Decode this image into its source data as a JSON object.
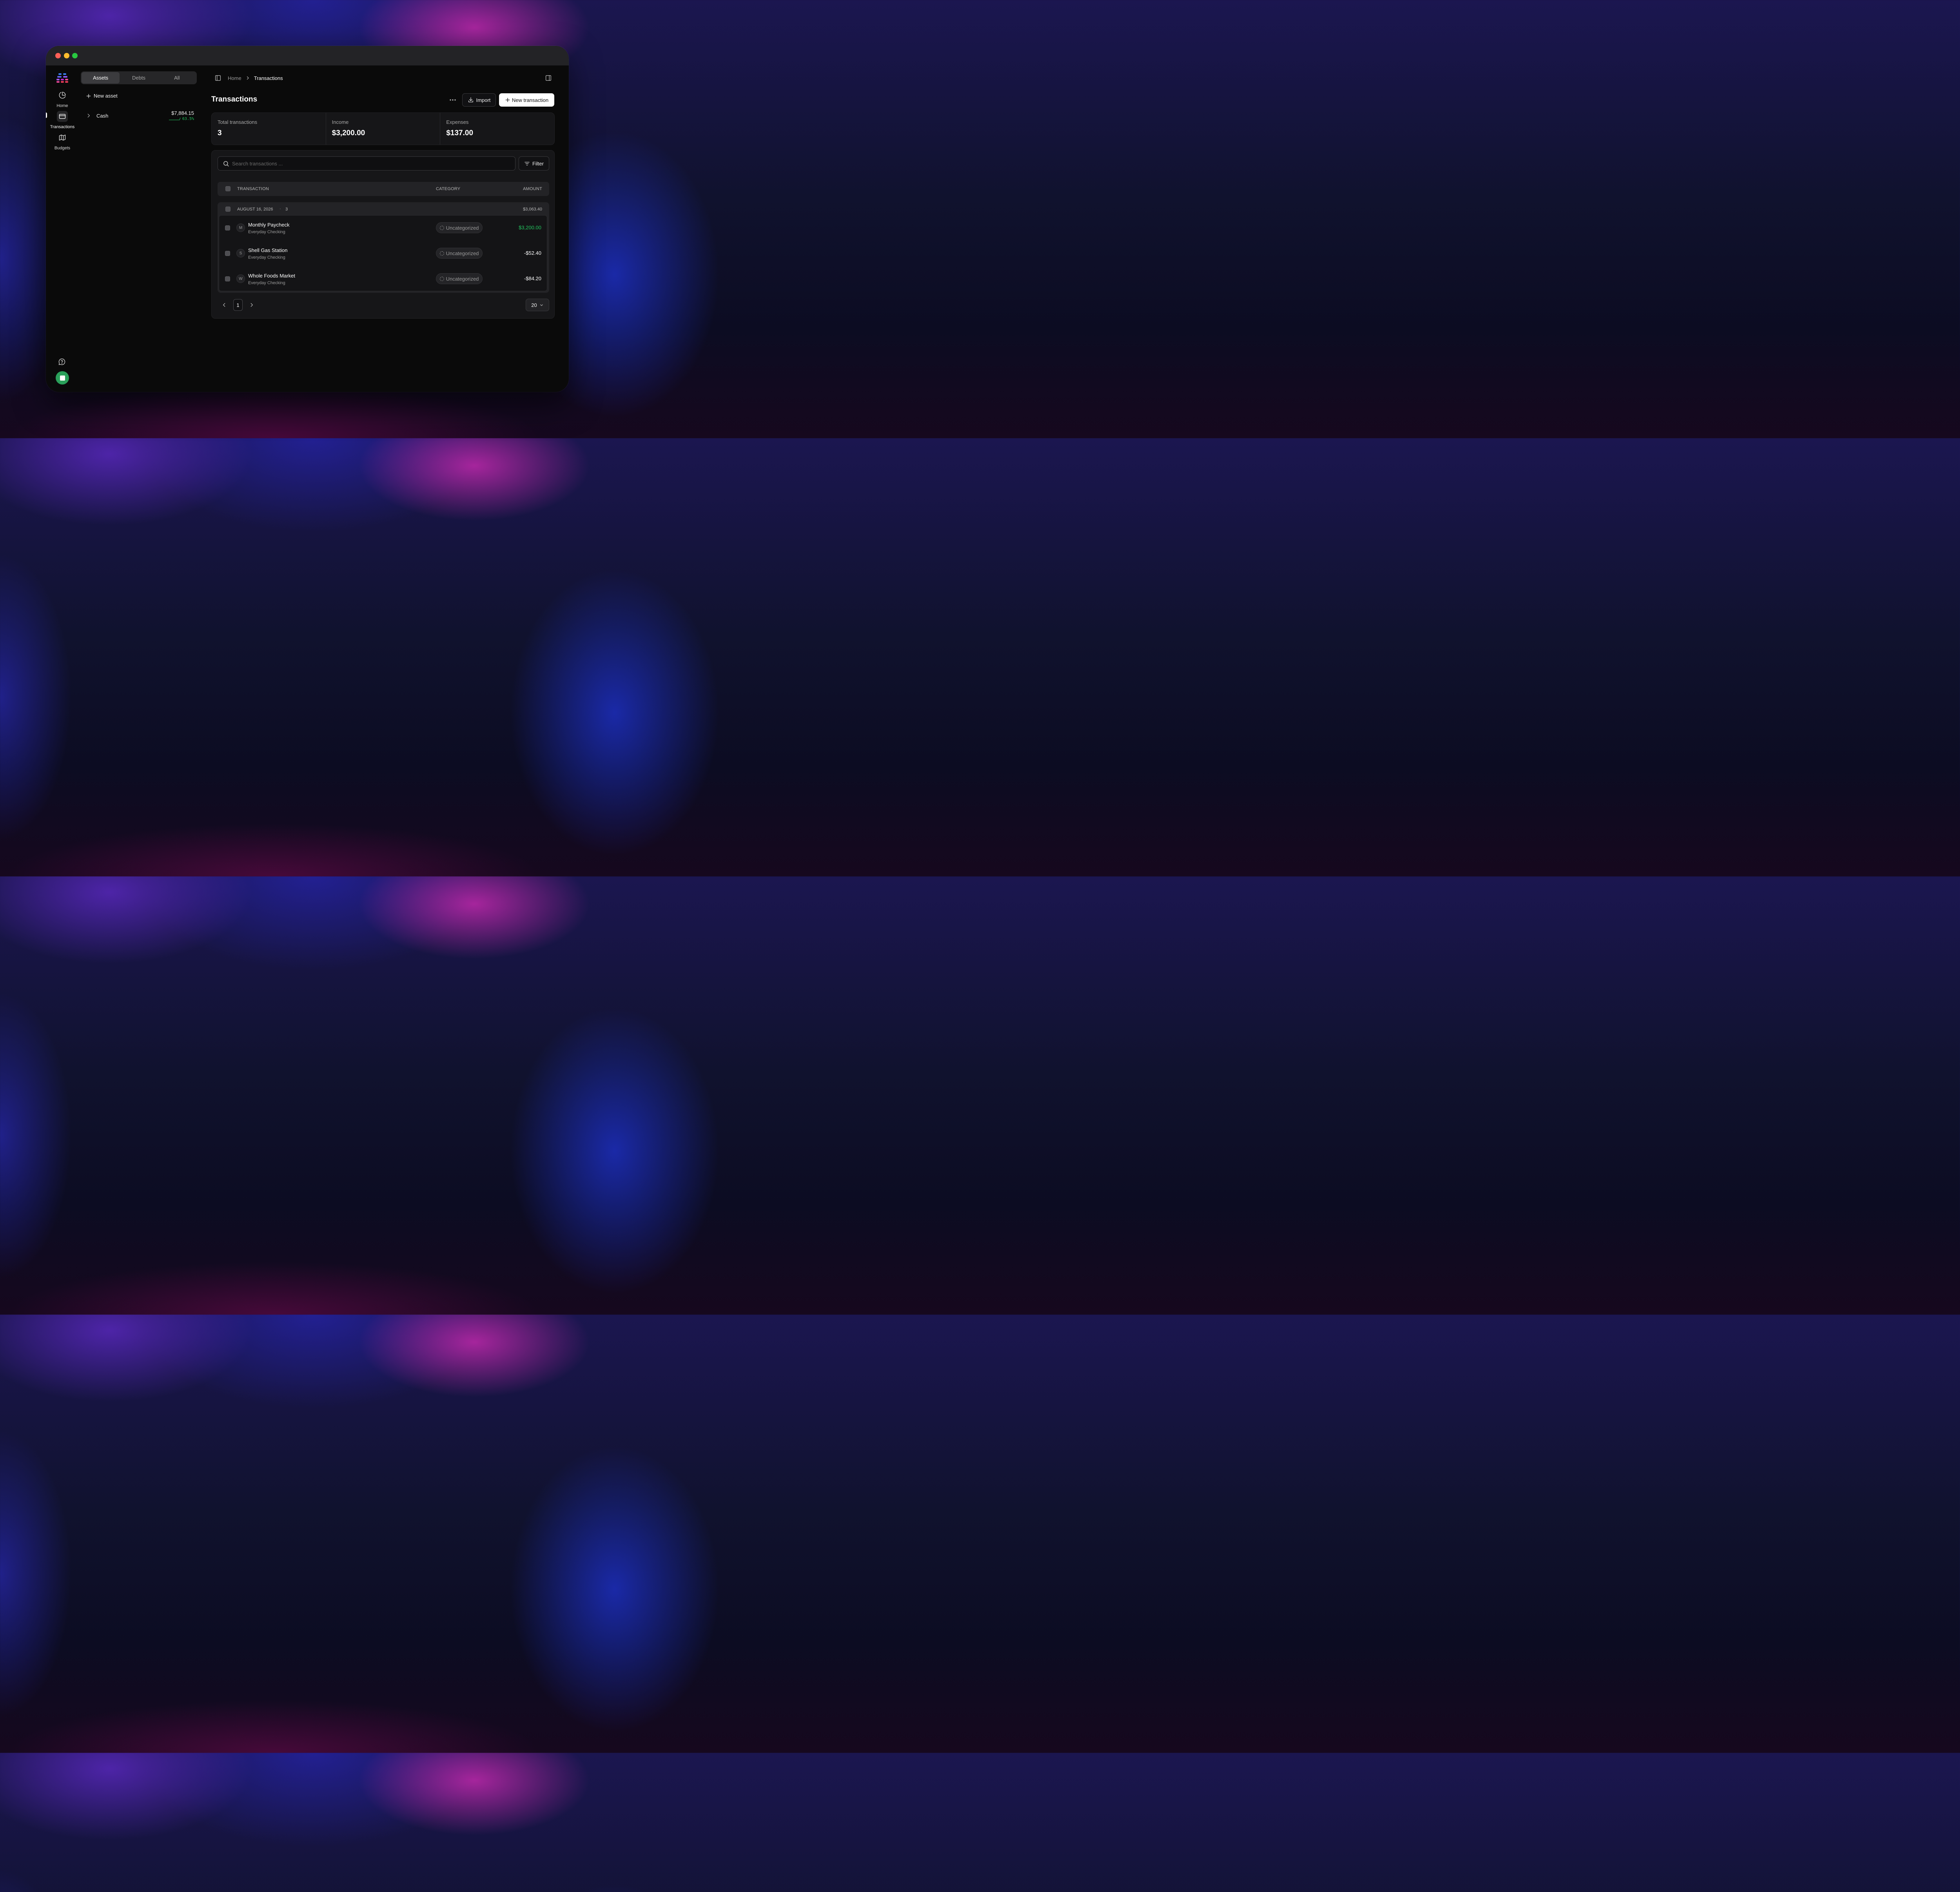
{
  "colors": {
    "accent_green": "#22c55e",
    "window_bg": "#0a0a0a",
    "titlebar_bg": "#232326",
    "avatar_bg": "#2aa05a",
    "logo_colors": [
      "#3b82f6",
      "#8b5cf6",
      "#ec4899"
    ]
  },
  "rail": {
    "items": [
      {
        "label": "Home",
        "icon": "pie-chart-icon"
      },
      {
        "label": "Transactions",
        "icon": "credit-card-icon",
        "active": true
      },
      {
        "label": "Budgets",
        "icon": "map-icon"
      }
    ],
    "help_icon": "help-chat-icon",
    "avatar_icon": "square-icon"
  },
  "assets_panel": {
    "tabs": [
      {
        "label": "Assets",
        "active": true
      },
      {
        "label": "Debts"
      },
      {
        "label": "All"
      }
    ],
    "new_asset_label": "New asset",
    "accounts": [
      {
        "label": "Cash",
        "value": "$7,884.15",
        "change": "63.5%"
      }
    ]
  },
  "breadcrumb": {
    "home": "Home",
    "current": "Transactions"
  },
  "header": {
    "title": "Transactions",
    "import_label": "Import",
    "new_transaction_label": "New transaction"
  },
  "stats": [
    {
      "label": "Total transactions",
      "value": "3"
    },
    {
      "label": "Income",
      "value": "$3,200.00"
    },
    {
      "label": "Expenses",
      "value": "$137.00"
    }
  ],
  "search": {
    "placeholder": "Search transactions ..."
  },
  "filter_label": "Filter",
  "table": {
    "columns": {
      "transaction": "TRANSACTION",
      "category": "CATEGORY",
      "amount": "AMOUNT"
    },
    "groups": [
      {
        "date": "AUGUST 16, 2026",
        "separator": "·",
        "count": "3",
        "total": "$3,063.40",
        "rows": [
          {
            "initial": "M",
            "name": "Monthly Paycheck",
            "account": "Everyday Checking",
            "category": "Uncategorized",
            "amount": "$3,200.00",
            "positive": true
          },
          {
            "initial": "S",
            "name": "Shell Gas Station",
            "account": "Everyday Checking",
            "category": "Uncategorized",
            "amount": "-$52.40",
            "positive": false
          },
          {
            "initial": "W",
            "name": "Whole Foods Market",
            "account": "Everyday Checking",
            "category": "Uncategorized",
            "amount": "-$84.20",
            "positive": false
          }
        ]
      }
    ]
  },
  "pagination": {
    "current_page": "1",
    "per_page": "20"
  }
}
